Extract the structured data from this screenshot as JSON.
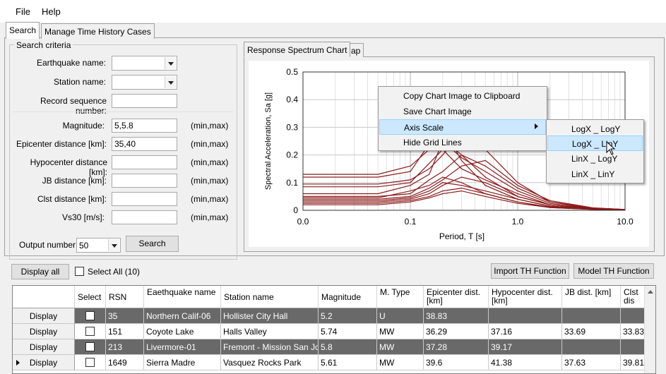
{
  "menu": {
    "file": "File",
    "help": "Help"
  },
  "tabs": {
    "search": "Search",
    "manage": "Manage Time History Cases"
  },
  "criteria": {
    "legend": "Search criteria",
    "earthquake_name": "Earthquake name:",
    "station_name": "Station name:",
    "rsn": "Record sequence number:",
    "magnitude": "Magnitude:",
    "magnitude_value": "5,5.8",
    "epicenter": "Epicenter distance [km]:",
    "epicenter_value": "35,40",
    "hypocenter": "Hypocenter distance [km]:",
    "jb": "JB distance [km]:",
    "clst": "Clst distance [km]:",
    "vs30": "Vs30 [m/s]:",
    "unit": "(min,max)",
    "output_label": "Output number:",
    "output_value": "50",
    "search_button": "Search"
  },
  "chart_tabs": {
    "spectrum": "Response Spectrum Chart",
    "map": "Map"
  },
  "chart_data": {
    "type": "line",
    "xlabel": "Period, T [s]",
    "ylabel": "Spectral Acceleration, Sa [g]",
    "x_ticks": [
      "0.0",
      "0.1",
      "1.0",
      "10.0"
    ],
    "y_ticks": [
      "0",
      "0.1",
      "0.2",
      "0.3",
      "0.4",
      "0.5"
    ],
    "ylim": [
      0,
      0.5
    ],
    "x_scale": "log",
    "grid": true,
    "line_color": "#8b1a1a",
    "series": [
      {
        "x": [
          0.01,
          0.05,
          0.1,
          0.15,
          0.2,
          0.3,
          0.5,
          1,
          2,
          5,
          10
        ],
        "values": [
          0.13,
          0.13,
          0.16,
          0.22,
          0.26,
          0.2,
          0.12,
          0.05,
          0.02,
          0.006,
          0.003
        ]
      },
      {
        "x": [
          0.01,
          0.05,
          0.1,
          0.15,
          0.2,
          0.3,
          0.5,
          1,
          2,
          5,
          10
        ],
        "values": [
          0.12,
          0.12,
          0.14,
          0.24,
          0.3,
          0.18,
          0.09,
          0.04,
          0.015,
          0.005,
          0.002
        ]
      },
      {
        "x": [
          0.01,
          0.05,
          0.1,
          0.15,
          0.2,
          0.3,
          0.5,
          1,
          2,
          5,
          10
        ],
        "values": [
          0.095,
          0.095,
          0.11,
          0.15,
          0.2,
          0.28,
          0.22,
          0.1,
          0.03,
          0.008,
          0.003
        ]
      },
      {
        "x": [
          0.01,
          0.05,
          0.1,
          0.15,
          0.2,
          0.3,
          0.5,
          1,
          2,
          5,
          10
        ],
        "values": [
          0.085,
          0.085,
          0.1,
          0.17,
          0.22,
          0.15,
          0.11,
          0.06,
          0.02,
          0.006,
          0.002
        ]
      },
      {
        "x": [
          0.01,
          0.05,
          0.1,
          0.15,
          0.2,
          0.3,
          0.5,
          1,
          2,
          5,
          10
        ],
        "values": [
          0.06,
          0.06,
          0.09,
          0.13,
          0.25,
          0.19,
          0.14,
          0.07,
          0.025,
          0.007,
          0.002
        ]
      },
      {
        "x": [
          0.01,
          0.05,
          0.1,
          0.15,
          0.2,
          0.3,
          0.5,
          1,
          2,
          5,
          10
        ],
        "values": [
          0.05,
          0.05,
          0.06,
          0.11,
          0.14,
          0.2,
          0.16,
          0.08,
          0.03,
          0.008,
          0.003
        ]
      },
      {
        "x": [
          0.01,
          0.05,
          0.1,
          0.15,
          0.2,
          0.3,
          0.5,
          1,
          2,
          5,
          10
        ],
        "values": [
          0.045,
          0.045,
          0.07,
          0.09,
          0.12,
          0.1,
          0.06,
          0.03,
          0.012,
          0.004,
          0.001
        ]
      },
      {
        "x": [
          0.01,
          0.05,
          0.1,
          0.15,
          0.2,
          0.3,
          0.5,
          1,
          2,
          5,
          10
        ],
        "values": [
          0.04,
          0.04,
          0.05,
          0.08,
          0.11,
          0.16,
          0.18,
          0.09,
          0.035,
          0.009,
          0.003
        ]
      },
      {
        "x": [
          0.01,
          0.05,
          0.1,
          0.15,
          0.2,
          0.3,
          0.5,
          1,
          2,
          5,
          10
        ],
        "values": [
          0.035,
          0.035,
          0.045,
          0.07,
          0.1,
          0.09,
          0.07,
          0.04,
          0.015,
          0.004,
          0.001
        ]
      },
      {
        "x": [
          0.01,
          0.05,
          0.1,
          0.15,
          0.2,
          0.3,
          0.5,
          1,
          2,
          5,
          10
        ],
        "values": [
          0.03,
          0.03,
          0.04,
          0.06,
          0.09,
          0.12,
          0.1,
          0.05,
          0.02,
          0.005,
          0.002
        ]
      },
      {
        "x": [
          0.01,
          0.05,
          0.1,
          0.15,
          0.2,
          0.3,
          0.5,
          1,
          2,
          5,
          10
        ],
        "values": [
          0.025,
          0.025,
          0.035,
          0.05,
          0.07,
          0.08,
          0.06,
          0.03,
          0.01,
          0.003,
          0.001
        ]
      },
      {
        "x": [
          0.01,
          0.05,
          0.1,
          0.15,
          0.2,
          0.3,
          0.5,
          1,
          2,
          5,
          10
        ],
        "values": [
          0.02,
          0.02,
          0.03,
          0.045,
          0.06,
          0.07,
          0.05,
          0.025,
          0.01,
          0.003,
          0.001
        ]
      }
    ]
  },
  "context_menu": {
    "items": [
      "Copy Chart Image to Clipboard",
      "Save Chart Image",
      "Axis Scale",
      "Hide Grid Lines"
    ],
    "submenu": [
      "LogX _ LogY",
      "LogX _ LinY",
      "LinX _ LogY",
      "LinX _ LinY"
    ]
  },
  "toolbar": {
    "display_all": "Display all",
    "select_all": "Select All (10)",
    "import_th": "Import TH Function",
    "model_th": "Model TH Function"
  },
  "grid": {
    "headers": [
      "Select",
      "RSN",
      "Eaethquake name",
      "Station name",
      "Magnitude",
      "M. Type",
      "Epicenter dist. [km]",
      "Hypocenter dist. [km]",
      "JB dist. [km]",
      "Clst dis"
    ],
    "rows": [
      {
        "display": "Display",
        "rsn": "35",
        "eq": "Northern Calif-06",
        "station": "Hollister City Hall",
        "mag": "5.2",
        "mtype": "U",
        "epi": "38.83",
        "hypo": "",
        "jb": "",
        "clst": ""
      },
      {
        "display": "Display",
        "rsn": "151",
        "eq": "Coyote Lake",
        "station": "Halls Valley",
        "mag": "5.74",
        "mtype": "MW",
        "epi": "36.29",
        "hypo": "37.16",
        "jb": "33.69",
        "clst": "33.83"
      },
      {
        "display": "Display",
        "rsn": "213",
        "eq": "Livermore-01",
        "station": "Fremont - Mission San Jose",
        "mag": "5.8",
        "mtype": "MW",
        "epi": "37.28",
        "hypo": "39.17",
        "jb": "",
        "clst": ""
      },
      {
        "display": "Display",
        "rsn": "1649",
        "eq": "Sierra Madre",
        "station": "Vasquez Rocks Park",
        "mag": "5.61",
        "mtype": "MW",
        "epi": "39.6",
        "hypo": "41.38",
        "jb": "37.63",
        "clst": "39.81"
      }
    ]
  }
}
